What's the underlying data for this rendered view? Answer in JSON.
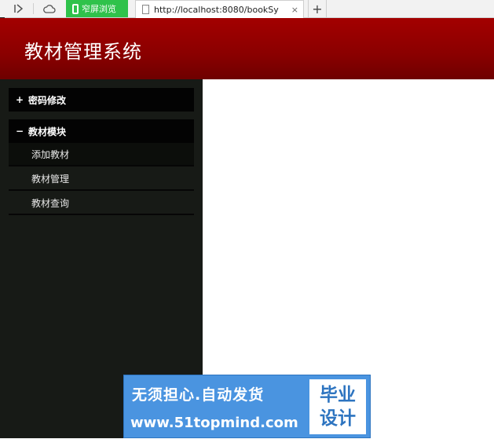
{
  "browser": {
    "mode_tab_label": "窄屏浏览",
    "url_tab_title": "http://localhost:8080/bookSy",
    "close_glyph": "×",
    "new_tab_glyph": "+"
  },
  "header": {
    "title": "教材管理系统"
  },
  "sidebar": {
    "sections": [
      {
        "toggle": "+",
        "label": "密码修改",
        "items": []
      },
      {
        "toggle": "−",
        "label": "教材模块",
        "items": [
          {
            "label": "添加教材",
            "active": true
          },
          {
            "label": "教材管理",
            "active": false
          },
          {
            "label": "教材查询",
            "active": false
          }
        ]
      }
    ]
  },
  "watermark": {
    "line1": "无须担心.自动发货",
    "line2": "www.51topmind.com",
    "badge_line1": "毕业",
    "badge_line2": "设计"
  },
  "colors": {
    "header": "#8a0000",
    "sidebar": "#171a16",
    "section_head": "#030303",
    "mode_tab": "#2fc24b",
    "watermark": "#4a94e0"
  }
}
